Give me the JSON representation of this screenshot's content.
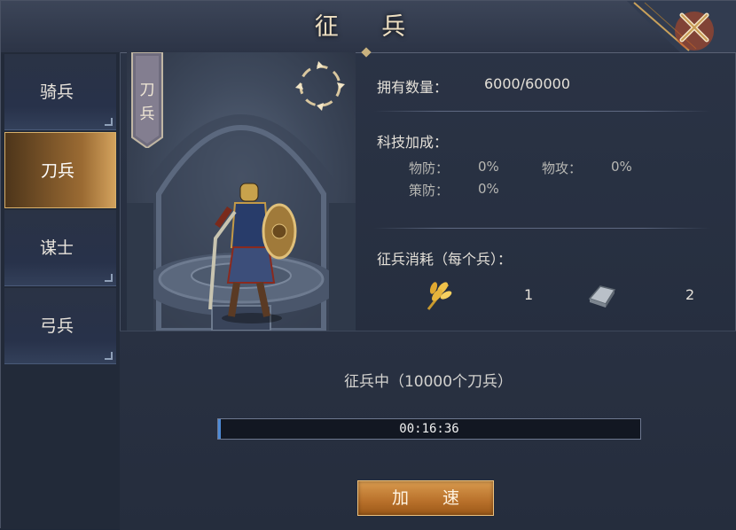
{
  "title": "征 兵",
  "sidebar": {
    "items": [
      {
        "label": "骑兵",
        "active": false
      },
      {
        "label": "刀兵",
        "active": true
      },
      {
        "label": "谋士",
        "active": false
      },
      {
        "label": "弓兵",
        "active": false
      }
    ]
  },
  "portrait": {
    "banner_line1": "刀",
    "banner_line2": "兵"
  },
  "info": {
    "owned_label": "拥有数量：",
    "owned_value": "6000/60000",
    "tech_label": "科技加成：",
    "phys_def_label": "物防：",
    "phys_def_value": "0%",
    "phys_atk_label": "物攻：",
    "phys_atk_value": "0%",
    "strat_def_label": "策防：",
    "strat_def_value": "0%",
    "cost_label": "征兵消耗（每个兵）：",
    "grain_cost": "1",
    "iron_cost": "2"
  },
  "recruit": {
    "status_text": "征兵中（10000个刀兵）",
    "timer": "00:16:36",
    "speedup_label": "加 速"
  },
  "colors": {
    "accent_gold": "#d8b06a",
    "button_orange": "#b8702a"
  },
  "icons": {
    "close": "close-icon",
    "rotate": "rotate-icon",
    "grain": "wheat-icon",
    "iron": "iron-ingot-icon"
  }
}
